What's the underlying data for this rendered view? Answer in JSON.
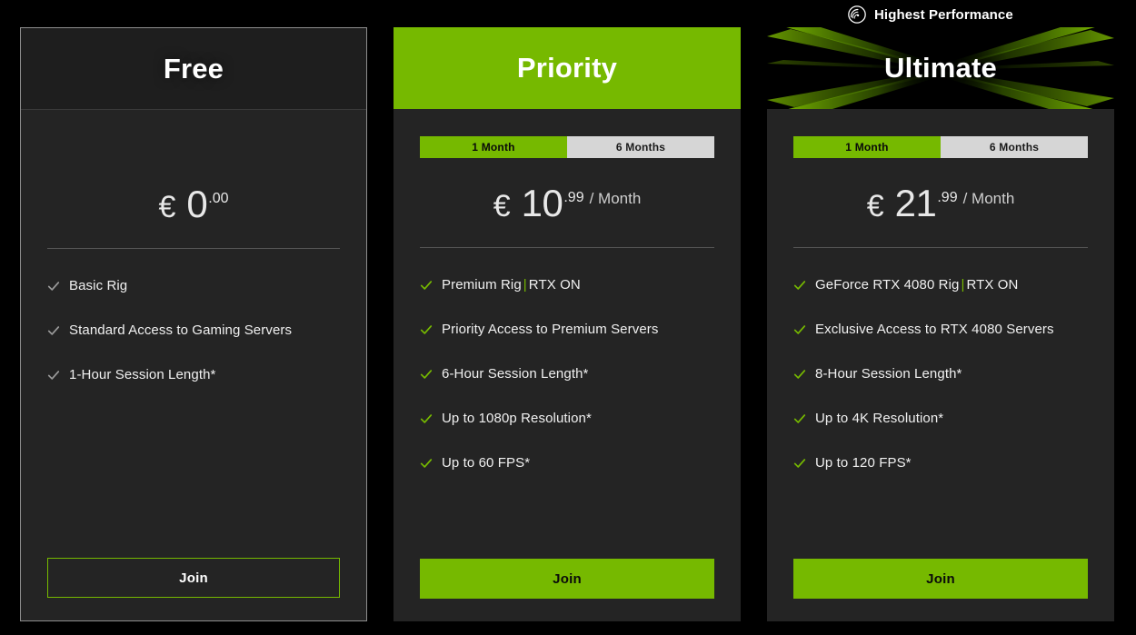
{
  "badge": {
    "icon": "performance-gauge-icon",
    "label": "Highest Performance"
  },
  "colors": {
    "brand_green": "#76b900",
    "page_background": "#000000",
    "card_background": "#242424",
    "toggle_inactive": "#d6d6d6",
    "check_gray": "#9a9a9a"
  },
  "cards": [
    {
      "id": "free",
      "title": "Free",
      "has_toggle": false,
      "price": {
        "currency": "€",
        "amount": "0",
        "cents": ".00",
        "period": ""
      },
      "check_style": "gray",
      "features": [
        {
          "text": "Basic Rig"
        },
        {
          "text": "Standard Access to Gaming Servers"
        },
        {
          "text": "1-Hour Session Length*"
        }
      ],
      "cta": {
        "label": "Join",
        "style": "outline"
      }
    },
    {
      "id": "priority",
      "title": "Priority",
      "has_toggle": true,
      "toggle": {
        "options": [
          "1 Month",
          "6 Months"
        ],
        "selected": "1 Month"
      },
      "price": {
        "currency": "€",
        "amount": "10",
        "cents": ".99",
        "period": "/ Month"
      },
      "check_style": "green",
      "features": [
        {
          "text": "Premium Rig",
          "separator": "|",
          "suffix": "RTX ON"
        },
        {
          "text": "Priority Access to Premium Servers"
        },
        {
          "text": "6-Hour Session Length*"
        },
        {
          "text": "Up to 1080p Resolution*"
        },
        {
          "text": "Up to 60 FPS*"
        }
      ],
      "cta": {
        "label": "Join",
        "style": "solid"
      }
    },
    {
      "id": "ultimate",
      "title": "Ultimate",
      "has_toggle": true,
      "toggle": {
        "options": [
          "1 Month",
          "6 Months"
        ],
        "selected": "1 Month"
      },
      "price": {
        "currency": "€",
        "amount": "21",
        "cents": ".99",
        "period": "/ Month"
      },
      "check_style": "green",
      "features": [
        {
          "text": "GeForce RTX 4080 Rig",
          "separator": "|",
          "suffix": "RTX ON"
        },
        {
          "text": "Exclusive Access to RTX 4080 Servers"
        },
        {
          "text": "8-Hour Session Length*"
        },
        {
          "text": "Up to 4K Resolution*"
        },
        {
          "text": "Up to 120 FPS*"
        }
      ],
      "cta": {
        "label": "Join",
        "style": "solid"
      }
    }
  ]
}
